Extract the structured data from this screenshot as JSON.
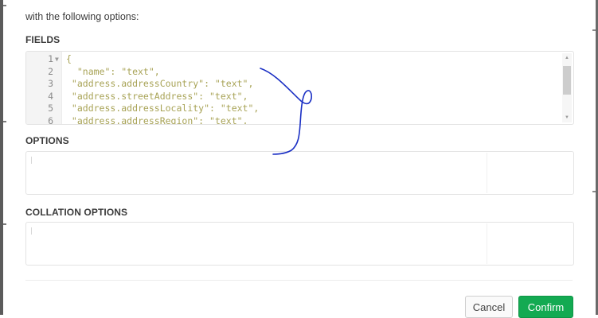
{
  "intro_text": "with the following options:",
  "sections": {
    "fields_label": "FIELDS",
    "options_label": "OPTIONS",
    "collation_label": "COLLATION OPTIONS"
  },
  "editor": {
    "lines": [
      {
        "num": "1",
        "text": "{",
        "fold": true
      },
      {
        "num": "2",
        "text": "  \"name\": \"text\","
      },
      {
        "num": "3",
        "text": " \"address.addressCountry\": \"text\","
      },
      {
        "num": "4",
        "text": " \"address.streetAddress\": \"text\","
      },
      {
        "num": "5",
        "text": " \"address.addressLocality\": \"text\","
      },
      {
        "num": "6",
        "text": " \"address.addressRegion\": \"text\","
      }
    ]
  },
  "buttons": {
    "cancel": "Cancel",
    "confirm": "Confirm"
  },
  "colors": {
    "confirm": "#13aa52",
    "code_text": "#a8a356",
    "scribble": "#1a2fc4"
  },
  "icons": {
    "fold": "fold-arrow-icon",
    "scroll_up": "scroll-up-arrow-icon",
    "scroll_down": "scroll-down-arrow-icon"
  }
}
